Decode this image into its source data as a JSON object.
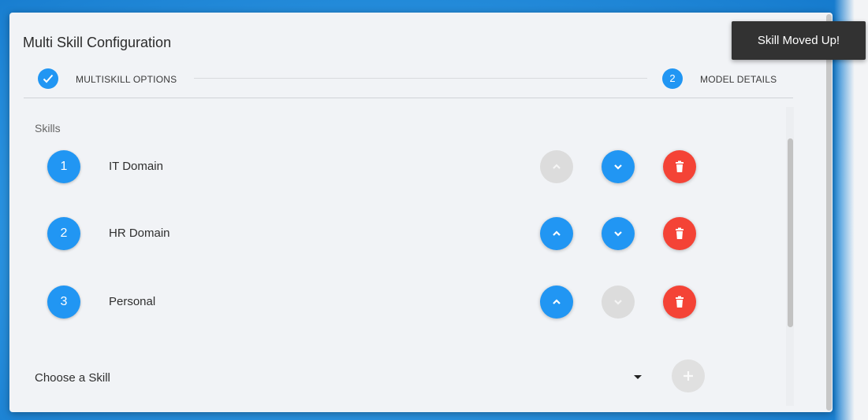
{
  "dialog": {
    "title": "Multi Skill Configuration"
  },
  "stepper": {
    "steps": [
      {
        "label": "MULTISKILL OPTIONS",
        "state": "completed",
        "icon": "check-icon"
      },
      {
        "label": "MODEL DETAILS",
        "state": "active",
        "number": "2"
      }
    ]
  },
  "skills": {
    "section_label": "Skills",
    "items": [
      {
        "number": "1",
        "name": "IT Domain",
        "move_up_enabled": false,
        "move_down_enabled": true
      },
      {
        "number": "2",
        "name": "HR Domain",
        "move_up_enabled": true,
        "move_down_enabled": true
      },
      {
        "number": "3",
        "name": "Personal",
        "move_up_enabled": true,
        "move_down_enabled": false
      }
    ],
    "choose_placeholder": "Choose a Skill"
  },
  "toast": {
    "message": "Skill Moved Up!"
  },
  "colors": {
    "primary": "#2196f3",
    "danger": "#f44336",
    "disabled": "#dcdcdc",
    "toast_bg": "#323232"
  }
}
